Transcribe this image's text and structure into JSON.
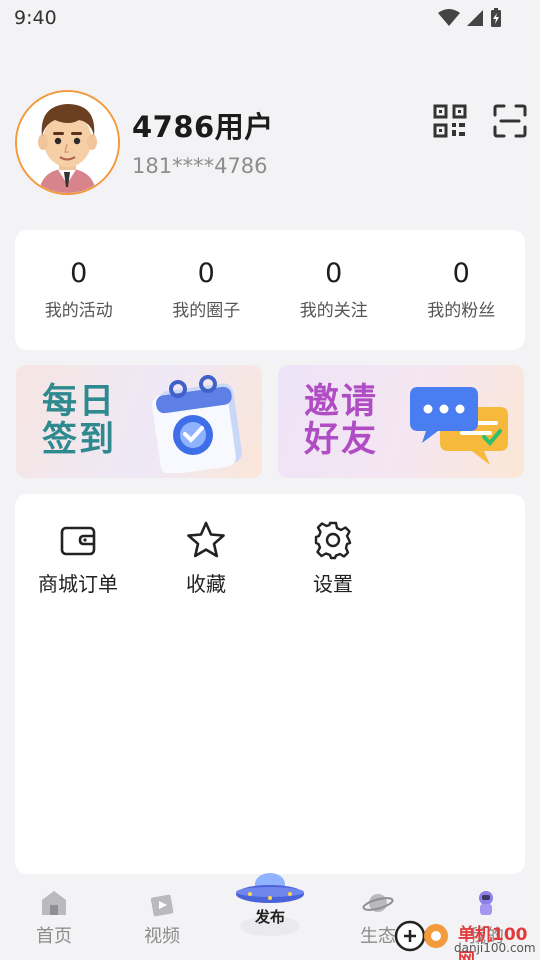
{
  "status_bar": {
    "time": "9:40"
  },
  "profile": {
    "username": "4786用户",
    "phone": "181****4786"
  },
  "stats": [
    {
      "value": "0",
      "label": "我的活动"
    },
    {
      "value": "0",
      "label": "我的圈子"
    },
    {
      "value": "0",
      "label": "我的关注"
    },
    {
      "value": "0",
      "label": "我的粉丝"
    }
  ],
  "banners": {
    "checkin": {
      "line1": "每日",
      "line2": "签到"
    },
    "invite": {
      "line1": "邀请",
      "line2": "好友"
    }
  },
  "menu": [
    {
      "label": "商城订单",
      "icon": "wallet-icon"
    },
    {
      "label": "收藏",
      "icon": "star-icon"
    },
    {
      "label": "设置",
      "icon": "gear-icon"
    }
  ],
  "tabbar": {
    "home": "首页",
    "video": "视频",
    "publish": "发布",
    "ecology": "生态",
    "mine": "我的"
  },
  "watermark": {
    "brand": "单机100网",
    "url": "danji100.com"
  },
  "colors": {
    "accent_orange": "#f39a3c",
    "checkin_text": "#2e8a8e",
    "invite_text": "#b04cc4"
  }
}
